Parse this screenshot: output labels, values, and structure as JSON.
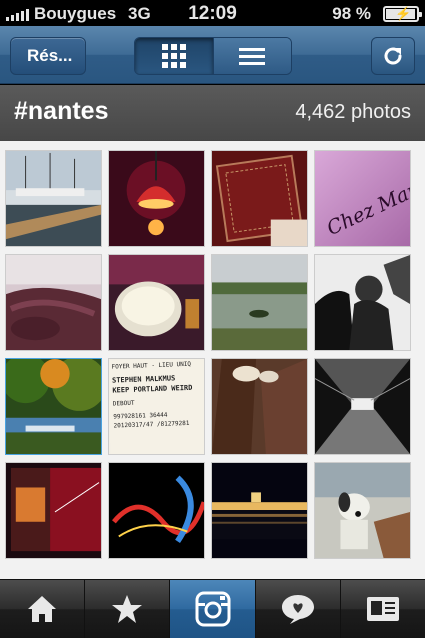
{
  "status_bar": {
    "carrier": "Bouygues",
    "network": "3G",
    "time": "12:09",
    "battery": "98 %",
    "battery_level": 0.98
  },
  "nav": {
    "back_label": "Rés...",
    "view_modes": [
      "grid-icon",
      "list-icon"
    ],
    "active_view": "grid",
    "refresh_icon": "refresh-icon"
  },
  "header": {
    "title": "#nantes",
    "count": "4,462 photos"
  },
  "tabs": [
    {
      "icon": "home-icon",
      "active": false
    },
    {
      "icon": "star-icon",
      "active": false
    },
    {
      "icon": "camera-icon",
      "active": true
    },
    {
      "icon": "comment-icon",
      "active": false
    },
    {
      "icon": "profile-card-icon",
      "active": false
    }
  ],
  "photos": [
    {
      "subject": "marina-boats"
    },
    {
      "subject": "red-lamp"
    },
    {
      "subject": "red-book-cover"
    },
    {
      "subject": "chez-maman-sign",
      "text": "Chez Maman"
    },
    {
      "subject": "leather-sofa"
    },
    {
      "subject": "cream-bowl"
    },
    {
      "subject": "pond-landscape"
    },
    {
      "subject": "bw-statue"
    },
    {
      "subject": "autumn-park"
    },
    {
      "subject": "concert-ticket",
      "lines": [
        "FOYER HAUT - LIEU UNIQ",
        "STEPHEN MALKMUS",
        "KEEP PORTLAND WEIRD",
        "DEBOUT",
        "997928161 36444",
        "20120317/47 /81279281"
      ]
    },
    {
      "subject": "sneakers-legs"
    },
    {
      "subject": "bw-bridge"
    },
    {
      "subject": "red-building-night"
    },
    {
      "subject": "light-trails"
    },
    {
      "subject": "city-night-river"
    },
    {
      "subject": "dog-on-sofa"
    }
  ]
}
